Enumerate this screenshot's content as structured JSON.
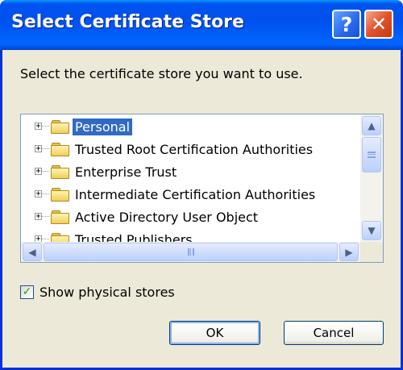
{
  "window": {
    "title": "Select Certificate Store",
    "help_label": "?",
    "close_label": "✕"
  },
  "dialog": {
    "instruction": "Select the certificate store you want to use."
  },
  "tree": {
    "items": [
      {
        "label": "Personal",
        "selected": true
      },
      {
        "label": "Trusted Root Certification Authorities"
      },
      {
        "label": "Enterprise Trust"
      },
      {
        "label": "Intermediate Certification Authorities"
      },
      {
        "label": "Active Directory User Object"
      },
      {
        "label": "Trusted Publishers"
      }
    ],
    "expander_symbol": "+"
  },
  "scrollbar": {
    "up_arrow": "▲",
    "down_arrow": "▼",
    "left_arrow": "◀",
    "right_arrow": "▶"
  },
  "options": {
    "show_physical_label": "Show physical stores",
    "show_physical_checked": true,
    "check_mark": "✓"
  },
  "buttons": {
    "ok_label": "OK",
    "cancel_label": "Cancel"
  },
  "colors": {
    "selection": "#316ac5",
    "title_bar": "#0054e3",
    "check": "#21a121"
  }
}
